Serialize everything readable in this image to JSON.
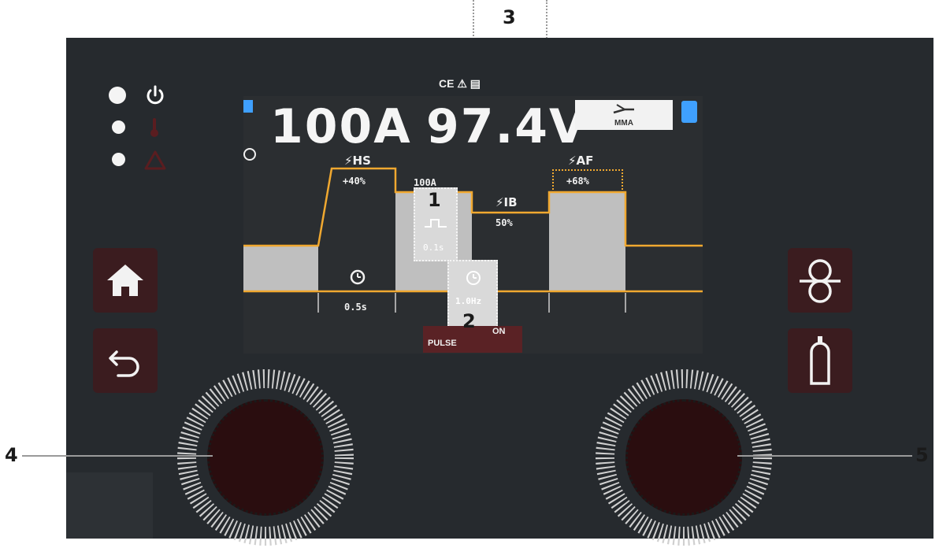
{
  "callouts": {
    "c1": "1",
    "c2": "2",
    "c3": "3",
    "c4": "4",
    "c5": "5"
  },
  "top_marks": "CE ⚠ ▤",
  "display": {
    "current": "100A",
    "voltage": "97.4V",
    "mode": "MMA"
  },
  "params": {
    "hs_label": "HS",
    "hs_value": "+40%",
    "peak_value": "100A",
    "ib_label": "IB",
    "ib_value": "50%",
    "af_label": "AF",
    "af_value": "+68%",
    "time_value": "0.5s",
    "freq_value": "1.0Hz",
    "pulse_word": "PULSE",
    "on_word": "ON",
    "sel1_text": "0.1s"
  },
  "colors": {
    "panel": "#262a2e",
    "screen": "#2b2e31",
    "waveform": "#f0a830",
    "button": "#3b1c1f",
    "accent_blue": "#3fa0ff",
    "knob": "#2a0d0f"
  },
  "icons": {
    "power": "power-icon",
    "thermometer": "thermometer-icon",
    "warning": "warning-icon",
    "home": "home-icon",
    "back": "back-arrow-icon",
    "wire_feed": "wire-spool-icon",
    "gas": "gas-cylinder-icon"
  }
}
